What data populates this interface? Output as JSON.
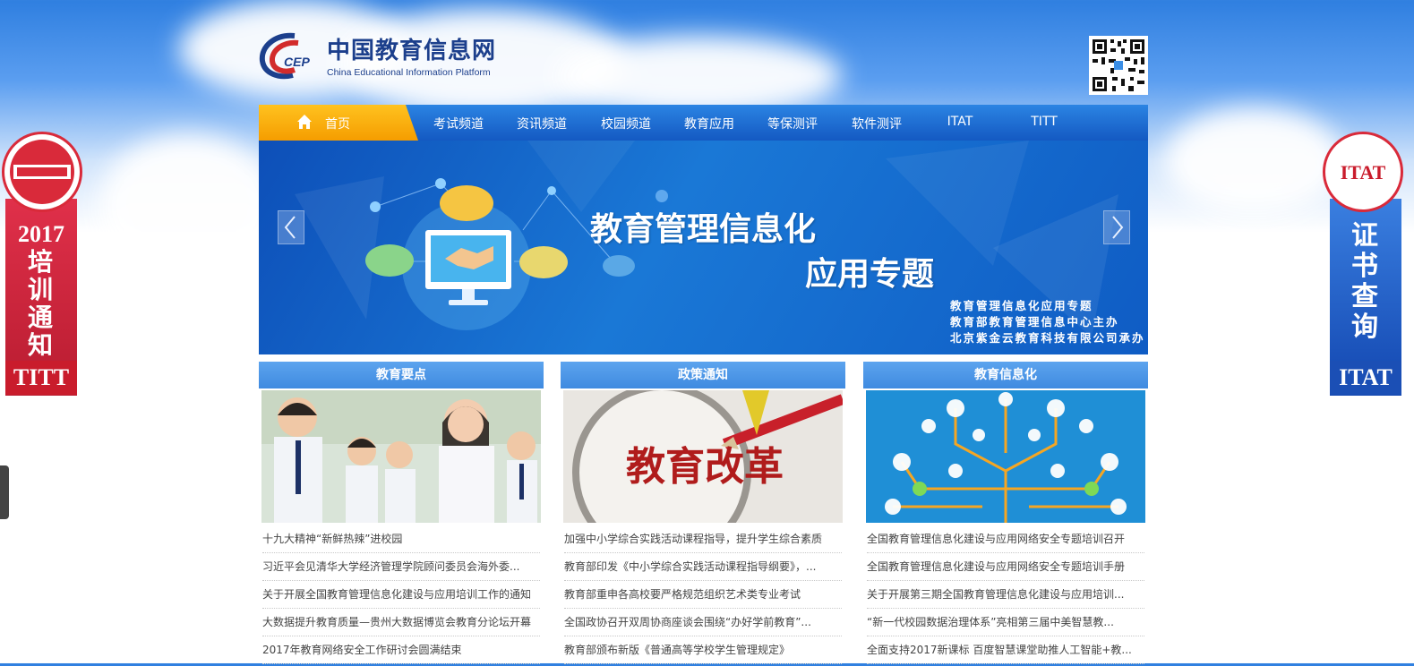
{
  "header": {
    "logo_cn": "中国教育信息网",
    "logo_en": "China Educational Information Platform",
    "logo_mark": "CEP"
  },
  "nav": {
    "home": "首页",
    "items": [
      "考试频道",
      "资讯频道",
      "校园频道",
      "教育应用",
      "等保测评",
      "软件测评",
      "ITAT",
      "TITT"
    ]
  },
  "banner": {
    "title_line1": "教育管理信息化",
    "title_line2": "应用专题",
    "sub1": "教育管理信息化应用专题",
    "sub2": "教育部教育管理信息中心主办",
    "sub3": "北京紫金云教育科技有限公司承办"
  },
  "side_left": {
    "year": "2017",
    "text": "培训通知",
    "badge": "TITT"
  },
  "side_right": {
    "logo": "ITAT",
    "text": "证书查询",
    "badge": "ITAT"
  },
  "columns": [
    {
      "title": "教育要点",
      "news": [
        "十九大精神“新鲜热辣”进校园",
        "习近平会见清华大学经济管理学院顾问委员会海外委...",
        "关于开展全国教育管理信息化建设与应用培训工作的通知",
        "大数据提升教育质量—贵州大数据博览会教育分论坛开幕",
        "2017年教育网络安全工作研讨会圆满结束"
      ]
    },
    {
      "title": "政策通知",
      "image_text": "教育改革",
      "news": [
        "加强中小学综合实践活动课程指导，提升学生综合素质",
        "教育部印发《中小学综合实践活动课程指导纲要》，...",
        "教育部重申各高校要严格规范组织艺术类专业考试",
        "全国政协召开双周协商座谈会围绕“办好学前教育”...",
        "教育部颁布新版《普通高等学校学生管理规定》"
      ]
    },
    {
      "title": "教育信息化",
      "news": [
        "全国教育管理信息化建设与应用网络安全专题培训召开",
        "全国教育管理信息化建设与应用网络安全专题培训手册",
        "关于开展第三期全国教育管理信息化建设与应用培训...",
        "“新一代校园数据治理体系”亮相第三届中美智慧教...",
        "全面支持2017新课标 百度智慧课堂助推人工智能+教..."
      ]
    }
  ]
}
